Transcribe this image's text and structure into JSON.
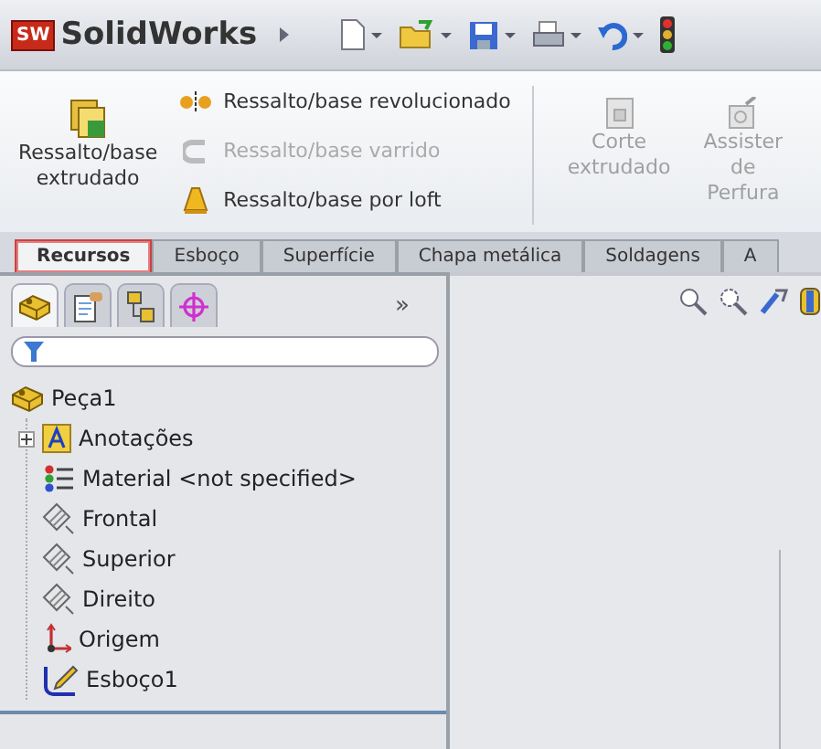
{
  "app": {
    "logo": "SW",
    "title": "SolidWorks"
  },
  "ribbon": {
    "large": [
      {
        "lines": [
          "Ressalto/base",
          "extrudado"
        ],
        "disabled": false,
        "kind": "extrude"
      }
    ],
    "small": [
      {
        "label": "Ressalto/base revolucionado",
        "disabled": false,
        "kind": "revolve"
      },
      {
        "label": "Ressalto/base varrido",
        "disabled": true,
        "kind": "sweep"
      },
      {
        "label": "Ressalto/base por loft",
        "disabled": false,
        "kind": "loft"
      }
    ],
    "large_right": [
      {
        "lines": [
          "Corte",
          "extrudado"
        ],
        "disabled": true,
        "kind": "cut"
      },
      {
        "lines": [
          "Assister",
          "de",
          "Perfura"
        ],
        "disabled": true,
        "kind": "hole"
      }
    ]
  },
  "tabs": [
    {
      "label": "Recursos",
      "selected": true,
      "highlighted": true
    },
    {
      "label": "Esboço",
      "selected": false,
      "highlighted": false
    },
    {
      "label": "Superfície",
      "selected": false,
      "highlighted": false
    },
    {
      "label": "Chapa metálica",
      "selected": false,
      "highlighted": false
    },
    {
      "label": "Soldagens",
      "selected": false,
      "highlighted": false
    },
    {
      "label": "A",
      "selected": false,
      "highlighted": false
    }
  ],
  "panel": {
    "tabs": [
      {
        "kind": "part",
        "selected": true
      },
      {
        "kind": "property",
        "selected": false
      },
      {
        "kind": "config",
        "selected": false
      },
      {
        "kind": "target",
        "selected": false
      }
    ],
    "more": "»",
    "tree": {
      "label": "Peça1",
      "kind": "part",
      "children": [
        {
          "label": "Anotações",
          "kind": "annotation",
          "expanded": false
        },
        {
          "label": "Material <not specified>",
          "kind": "material"
        },
        {
          "label": "Frontal",
          "kind": "plane"
        },
        {
          "label": "Superior",
          "kind": "plane"
        },
        {
          "label": "Direito",
          "kind": "plane"
        },
        {
          "label": "Origem",
          "kind": "origin"
        },
        {
          "label": "Esboço1",
          "kind": "sketch"
        }
      ]
    }
  }
}
